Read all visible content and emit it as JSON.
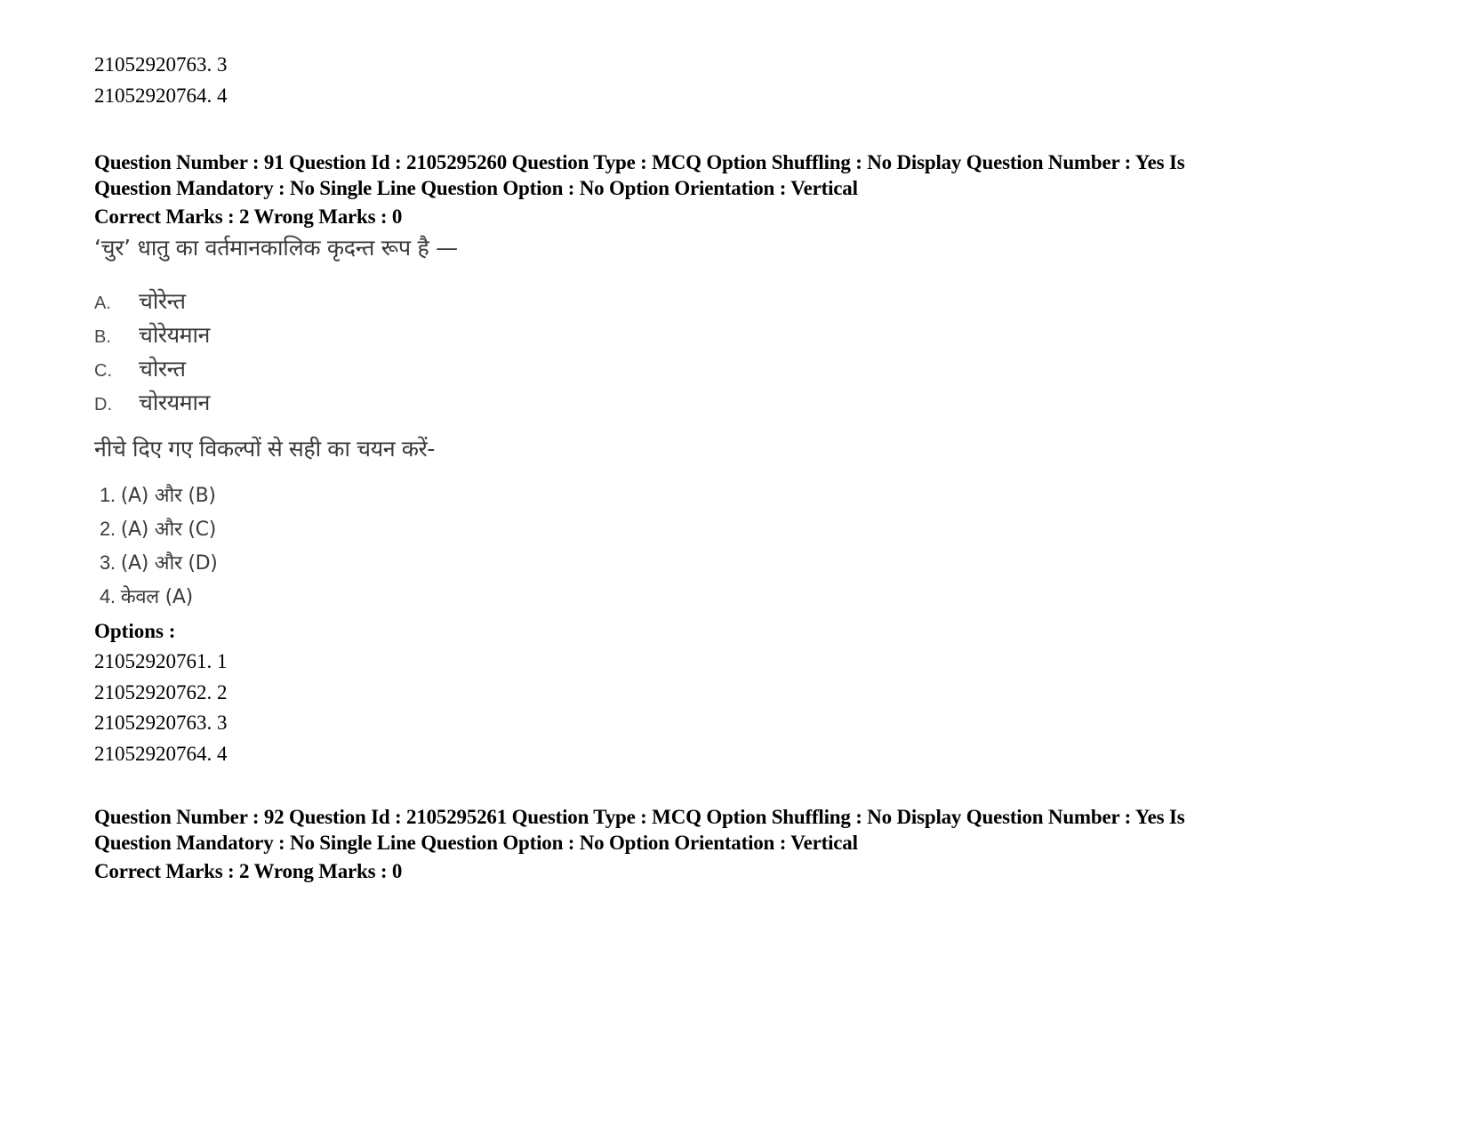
{
  "top_options": [
    {
      "id": "21052920763",
      "value": "3"
    },
    {
      "id": "21052920764",
      "value": "4"
    }
  ],
  "question_91": {
    "meta_line_1": "Question Number : 91 Question Id : 2105295260 Question Type : MCQ Option Shuffling : No Display Question Number : Yes Is",
    "meta_line_2": "Question Mandatory : No Single Line Question Option : No Option Orientation : Vertical",
    "marks": "Correct Marks : 2 Wrong Marks : 0",
    "stem": "‘चुर’ धातु का वर्तमानकालिक कृदन्त रूप है —",
    "items": [
      {
        "label": "A.",
        "text": "चोरेन्त"
      },
      {
        "label": "B.",
        "text": "चोरेयमान"
      },
      {
        "label": "C.",
        "text": "चोरन्त"
      },
      {
        "label": "D.",
        "text": "चोरयमान"
      }
    ],
    "instruction": "नीचे दिए गए विकल्पों से सही का चयन करें-",
    "choices": [
      {
        "num": "1.",
        "text": "(A)  और (B)"
      },
      {
        "num": "2.",
        "text": "(A)  और (C)"
      },
      {
        "num": "3.",
        "text": "(A)  और  (D)"
      },
      {
        "num": "4.",
        "text": "केवल (A)"
      }
    ],
    "options_heading": "Options :",
    "options": [
      {
        "id": "21052920761",
        "value": "1"
      },
      {
        "id": "21052920762",
        "value": "2"
      },
      {
        "id": "21052920763",
        "value": "3"
      },
      {
        "id": "21052920764",
        "value": "4"
      }
    ]
  },
  "question_92": {
    "meta_line_1": "Question Number : 92 Question Id : 2105295261 Question Type : MCQ Option Shuffling : No Display Question Number : Yes Is",
    "meta_line_2": "Question Mandatory : No Single Line Question Option : No Option Orientation : Vertical",
    "marks": "Correct Marks : 2 Wrong Marks : 0"
  }
}
